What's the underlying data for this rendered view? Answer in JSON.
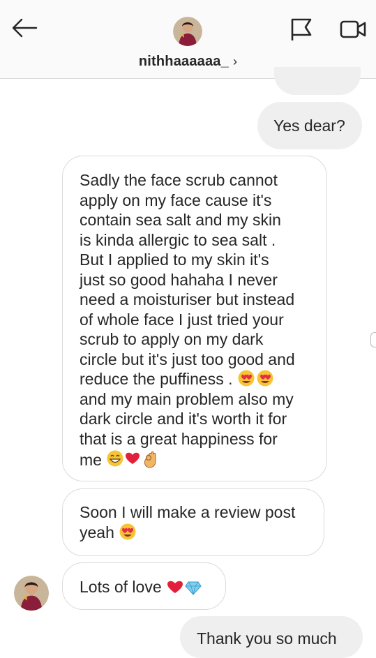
{
  "header": {
    "username": "nithhaaaaaa_",
    "chevron": "›",
    "back_icon": "arrow-left-icon",
    "flag_icon": "flag-icon",
    "video_icon": "video-camera-icon"
  },
  "messages": [
    {
      "type": "sent",
      "text": "Yes dear?"
    },
    {
      "type": "received",
      "lines": [
        "Sadly the face scrub cannot",
        "apply on my face cause it's",
        "contain sea salt and my skin",
        "is kinda allergic to sea salt .",
        "But I applied to my skin it's",
        "just so good hahaha I never",
        "need a moisturiser but instead",
        "of whole face I just tried your",
        "scrub to apply on my dark",
        "circle but it's just too good and",
        "reduce the puffiness .",
        "and my main problem also my",
        "dark circle and it's worth it for",
        "that is a great happiness for",
        "me"
      ]
    },
    {
      "type": "received",
      "lines": [
        "Soon I will make a review post",
        "yeah"
      ]
    },
    {
      "type": "received",
      "text": "Lots of love"
    },
    {
      "type": "sent",
      "text": "Thank you so much"
    }
  ],
  "colors": {
    "sent_bubble": "#efefef",
    "received_border": "#dbdbdb",
    "header_bg": "#fafafa",
    "text": "#262626"
  }
}
